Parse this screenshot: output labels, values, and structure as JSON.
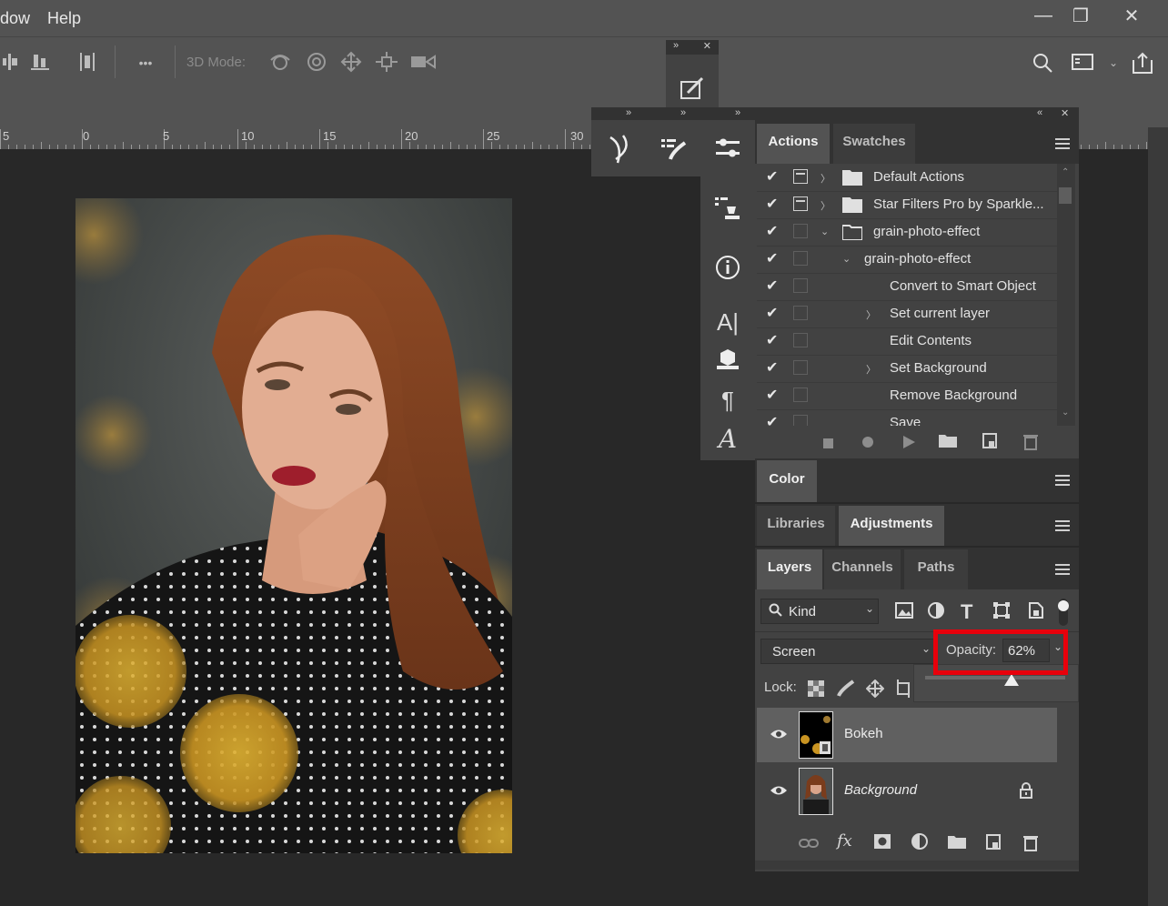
{
  "menu": {
    "items": [
      "dow",
      "Help"
    ]
  },
  "window_controls": {
    "minimize": "—",
    "restore": "❐",
    "close": "✕"
  },
  "optionsbar": {
    "mode_label": "3D Mode:",
    "more_label": "•••"
  },
  "ruler": {
    "labels": [
      "5",
      "0",
      "5",
      "10",
      "15",
      "20",
      "25",
      "30"
    ]
  },
  "actions_panel": {
    "tabs": [
      "Actions",
      "Swatches"
    ],
    "rows": [
      {
        "label": "Default Actions",
        "type": "set",
        "expanded": false
      },
      {
        "label": "Star Filters Pro by Sparkle...",
        "type": "set",
        "expanded": false
      },
      {
        "label": "grain-photo-effect",
        "type": "set",
        "expanded": true
      },
      {
        "label": "grain-photo-effect",
        "type": "action",
        "expanded": true
      },
      {
        "label": "Convert to Smart Object",
        "type": "step",
        "expanded": false
      },
      {
        "label": "Set current layer",
        "type": "step",
        "expanded": false,
        "has_arrow": true
      },
      {
        "label": "Edit Contents",
        "type": "step",
        "expanded": false
      },
      {
        "label": "Set Background",
        "type": "step",
        "expanded": false,
        "has_arrow": true
      },
      {
        "label": "Remove Background",
        "type": "step",
        "expanded": false
      },
      {
        "label": "Save",
        "type": "step",
        "expanded": false
      }
    ]
  },
  "color_panel": {
    "tab": "Color"
  },
  "adjust_panel": {
    "tabs": [
      "Libraries",
      "Adjustments"
    ]
  },
  "layers_panel": {
    "tabs": [
      "Layers",
      "Channels",
      "Paths"
    ],
    "filter_kind": "Kind",
    "blend_mode": "Screen",
    "opacity_label": "Opacity:",
    "opacity_value": "62%",
    "opacity_fraction": 0.62,
    "lock_label": "Lock:",
    "layers": [
      {
        "name": "Bokeh",
        "selected": true,
        "italic": false,
        "locked": false
      },
      {
        "name": "Background",
        "selected": false,
        "italic": true,
        "locked": true
      }
    ]
  },
  "colors": {
    "highlight": "#e8000b",
    "panel": "#424242",
    "selected_layer": "#606060"
  }
}
